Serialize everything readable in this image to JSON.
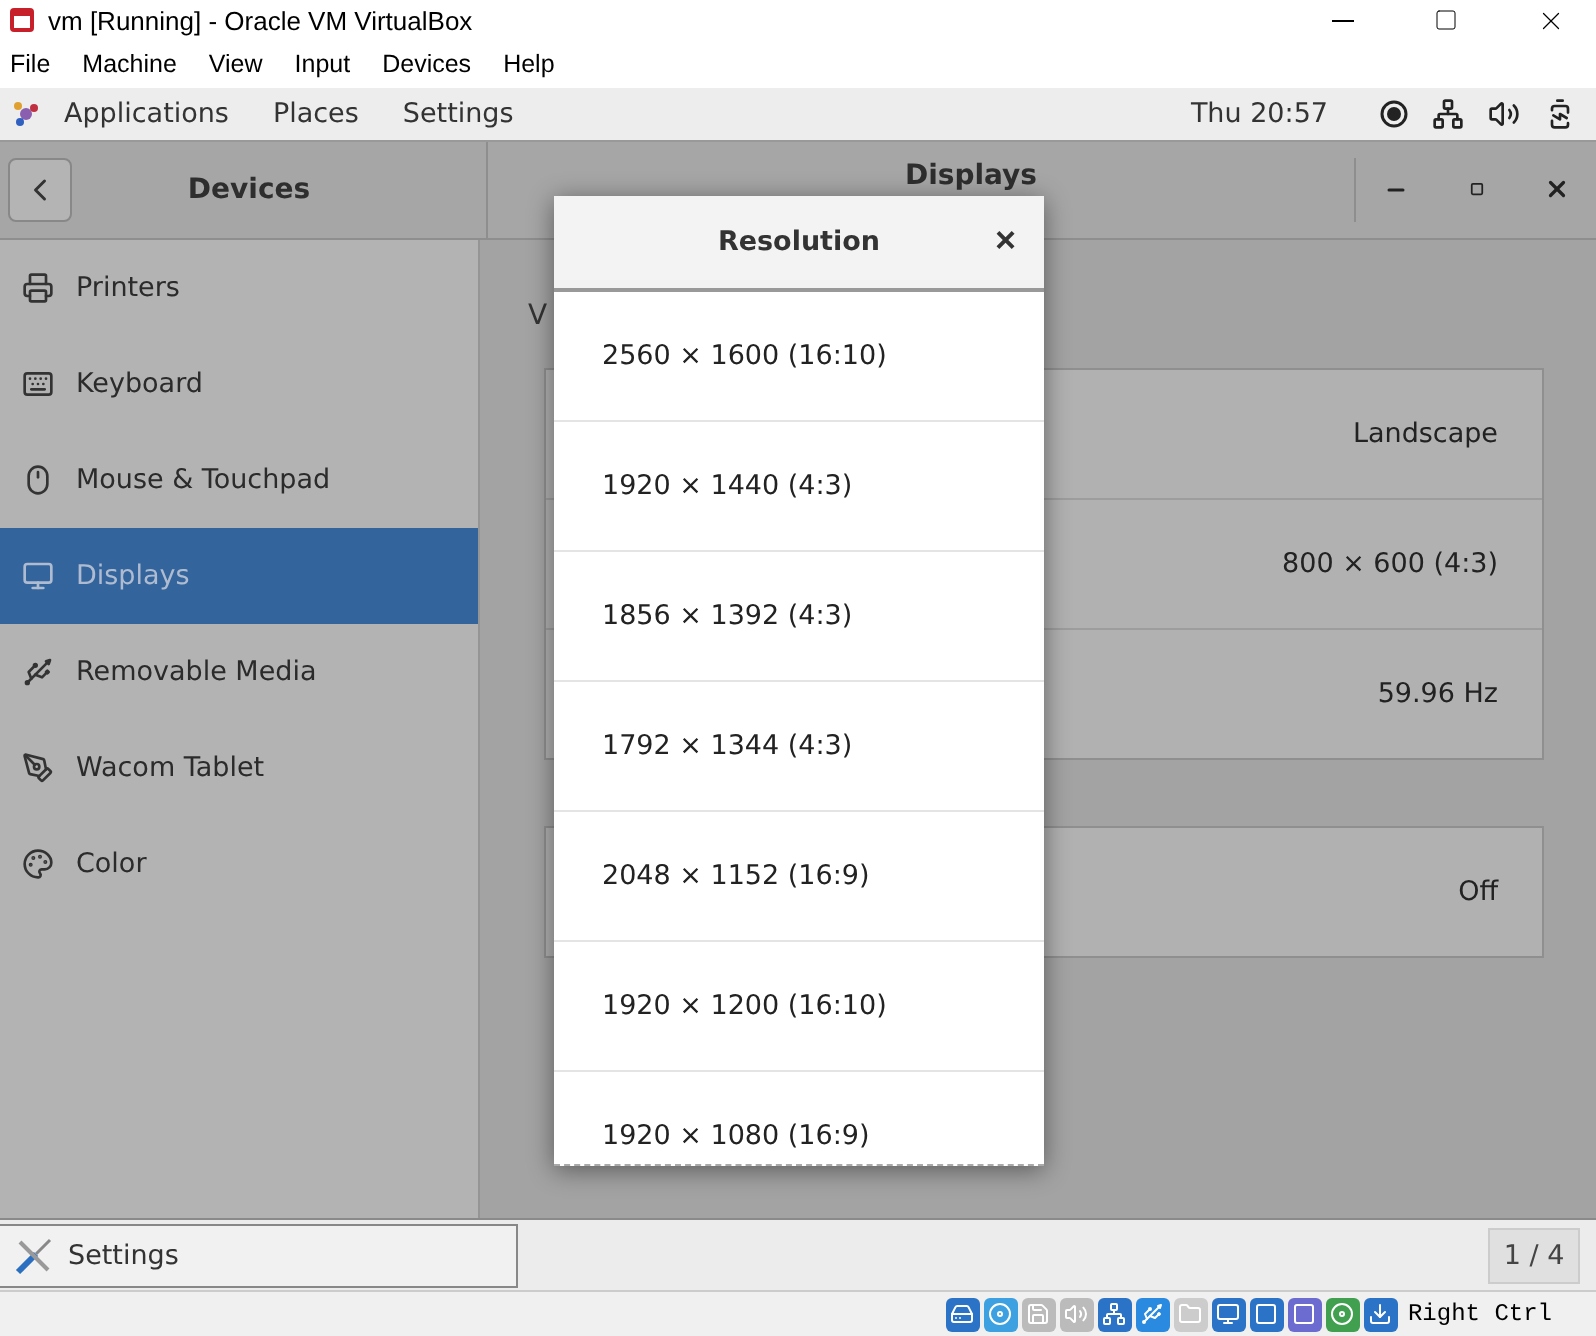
{
  "window": {
    "title": "vm [Running] - Oracle VM VirtualBox"
  },
  "menu": [
    "File",
    "Machine",
    "View",
    "Input",
    "Devices",
    "Help"
  ],
  "top_bar": {
    "items": [
      "Applications",
      "Places",
      "Settings"
    ],
    "clock": "Thu 20:57"
  },
  "settings": {
    "sidebar_title": "Devices",
    "panel_title": "Displays",
    "sidebar": [
      {
        "label": "Printers",
        "selected": false
      },
      {
        "label": "Keyboard",
        "selected": false
      },
      {
        "label": "Mouse & Touchpad",
        "selected": false
      },
      {
        "label": "Displays",
        "selected": true
      },
      {
        "label": "Removable Media",
        "selected": false
      },
      {
        "label": "Wacom Tablet",
        "selected": false
      },
      {
        "label": "Color",
        "selected": false
      }
    ],
    "section_label": "V",
    "cards": [
      {
        "rows": [
          {
            "value": "Landscape"
          },
          {
            "value": "800 × 600 (4:3)"
          },
          {
            "value": "59.96 Hz"
          }
        ]
      },
      {
        "rows": [
          {
            "value": "Off"
          }
        ]
      }
    ]
  },
  "dialog": {
    "title": "Resolution",
    "close": "×",
    "options": [
      "2560 × 1600 (16:10)",
      "1920 × 1440 (4:3)",
      "1856 × 1392 (4:3)",
      "1792 × 1344 (4:3)",
      "2048 × 1152 (16:9)",
      "1920 × 1200 (16:10)",
      "1920 × 1080 (16:9)"
    ]
  },
  "taskbar": {
    "window": "Settings",
    "pager": "1 / 4"
  },
  "status_bar": {
    "host_key": "Right Ctrl"
  }
}
